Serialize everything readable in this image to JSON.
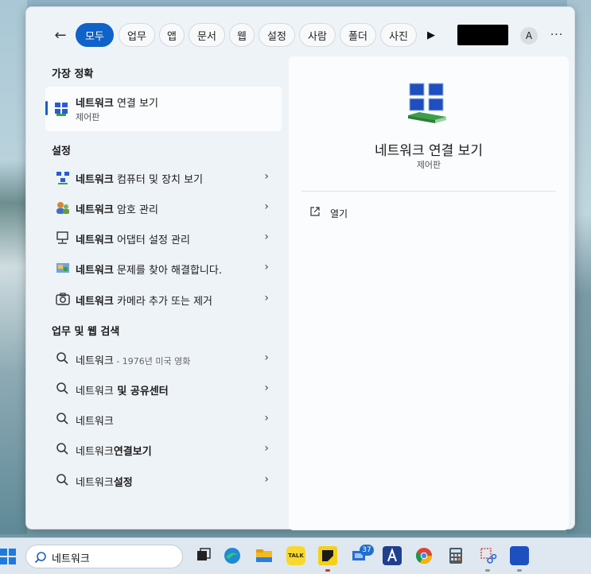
{
  "topbar": {
    "back_label": "←",
    "chips": [
      "모두",
      "업무",
      "앱",
      "문서",
      "웹",
      "설정",
      "사람",
      "폴더",
      "사진"
    ],
    "play_label": "▶",
    "avatar_label": "A",
    "more_label": "···"
  },
  "best_match": {
    "section_title": "가장 정확",
    "title_bold": "네트워크",
    "title_rest": " 연결 보기",
    "subtitle": "제어판"
  },
  "settings": {
    "section_title": "설정",
    "items": [
      {
        "bold": "네트워크",
        "rest": " 컴퓨터 및 장치 보기"
      },
      {
        "bold": "네트워크",
        "rest": " 암호 관리"
      },
      {
        "bold": "네트워크",
        "rest": " 어댑터 설정 관리"
      },
      {
        "bold": "네트워크",
        "rest": " 문제를 찾아 해결합니다."
      },
      {
        "bold": "네트워크",
        "rest": " 카메라 추가 또는 제거"
      }
    ]
  },
  "web_search": {
    "section_title": "업무 및 웹 검색",
    "items": [
      {
        "main": "네트워크",
        "small": " - 1976년 미국 영화",
        "bold": ""
      },
      {
        "main": "네트워크",
        "small": "",
        "bold": " 및 공유센터"
      },
      {
        "main": "네트워크",
        "small": "",
        "bold": ""
      },
      {
        "main": "네트워크",
        "small": "",
        "bold": "연결보기"
      },
      {
        "main": "네트워크",
        "small": "",
        "bold": "설정"
      }
    ]
  },
  "chevron": "›",
  "preview": {
    "title": "네트워크 연결 보기",
    "subtitle": "제어판",
    "open_label": "열기"
  },
  "taskbar": {
    "search_value": "네트워크",
    "badge_count": "37",
    "kakao_label": "TALK"
  },
  "colors": {
    "accent": "#0f62c8"
  }
}
